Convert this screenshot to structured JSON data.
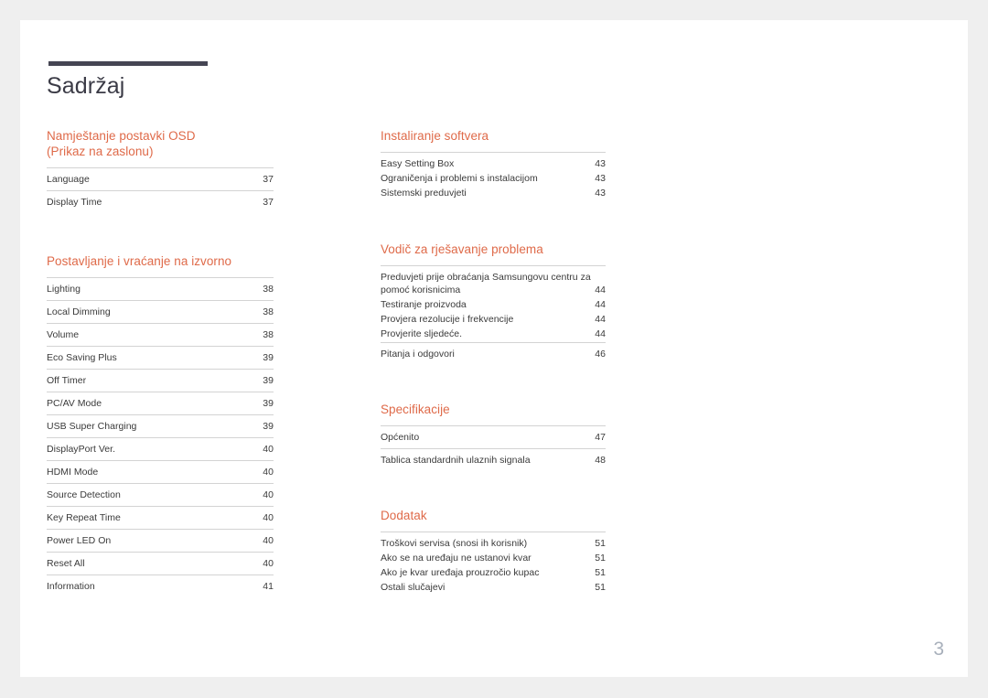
{
  "document": {
    "title": "Sadržaj",
    "page_number": "3",
    "accent_color": "#df6a49",
    "rule_color": "#454553",
    "text_color": "#3a3a3a",
    "page_number_color": "#a8b0bb"
  },
  "columns": {
    "left": [
      {
        "heading": "Namještanje postavki OSD\n(Prikaz na zaslonu)",
        "heading_line1": "Namještanje postavki OSD",
        "heading_line2": "(Prikaz na zaslonu)",
        "style": "ruled",
        "entries": [
          {
            "label": "Language",
            "page": "37"
          },
          {
            "label": "Display Time",
            "page": "37"
          }
        ]
      },
      {
        "heading": "Postavljanje i vraćanje na izvorno",
        "style": "ruled",
        "entries": [
          {
            "label": "Lighting",
            "page": "38"
          },
          {
            "label": "Local Dimming",
            "page": "38"
          },
          {
            "label": "Volume",
            "page": "38"
          },
          {
            "label": "Eco Saving Plus",
            "page": "39"
          },
          {
            "label": "Off Timer",
            "page": "39"
          },
          {
            "label": "PC/AV Mode",
            "page": "39"
          },
          {
            "label": "USB Super Charging",
            "page": "39"
          },
          {
            "label": "DisplayPort Ver.",
            "page": "40"
          },
          {
            "label": "HDMI Mode",
            "page": "40"
          },
          {
            "label": "Source Detection",
            "page": "40"
          },
          {
            "label": "Key Repeat Time",
            "page": "40"
          },
          {
            "label": "Power LED On",
            "page": "40"
          },
          {
            "label": "Reset All",
            "page": "40"
          },
          {
            "label": "Information",
            "page": "41"
          }
        ]
      }
    ],
    "right": [
      {
        "heading": "Instaliranje softvera",
        "style": "grouped",
        "entries": [
          {
            "label": "Easy Setting Box",
            "page": "43"
          },
          {
            "label": "Ograničenja i problemi s instalacijom",
            "page": "43"
          },
          {
            "label": "Sistemski preduvjeti",
            "page": "43"
          }
        ]
      },
      {
        "heading": "Vodič za rješavanje problema",
        "style": "grouped",
        "entries": [
          {
            "label": "Preduvjeti prije obraćanja Samsungovu centru za pomoć korisnicima",
            "page": "44",
            "wrap": true
          },
          {
            "label": "Testiranje proizvoda",
            "page": "44"
          },
          {
            "label": "Provjera rezolucije i frekvencije",
            "page": "44"
          },
          {
            "label": "Provjerite sljedeće.",
            "page": "44"
          }
        ],
        "extra_entries": [
          {
            "label": "Pitanja i odgovori",
            "page": "46"
          }
        ]
      },
      {
        "heading": "Specifikacije",
        "style": "ruled",
        "entries": [
          {
            "label": "Općenito",
            "page": "47"
          },
          {
            "label": "Tablica standardnih ulaznih signala",
            "page": "48"
          }
        ]
      },
      {
        "heading": "Dodatak",
        "style": "grouped",
        "entries": [
          {
            "label": "Troškovi servisa (snosi ih korisnik)",
            "page": "51"
          },
          {
            "label": "Ako se na uređaju ne ustanovi kvar",
            "page": "51"
          },
          {
            "label": "Ako je kvar uređaja prouzročio kupac",
            "page": "51"
          },
          {
            "label": "Ostali slučajevi",
            "page": "51"
          }
        ]
      }
    ]
  }
}
